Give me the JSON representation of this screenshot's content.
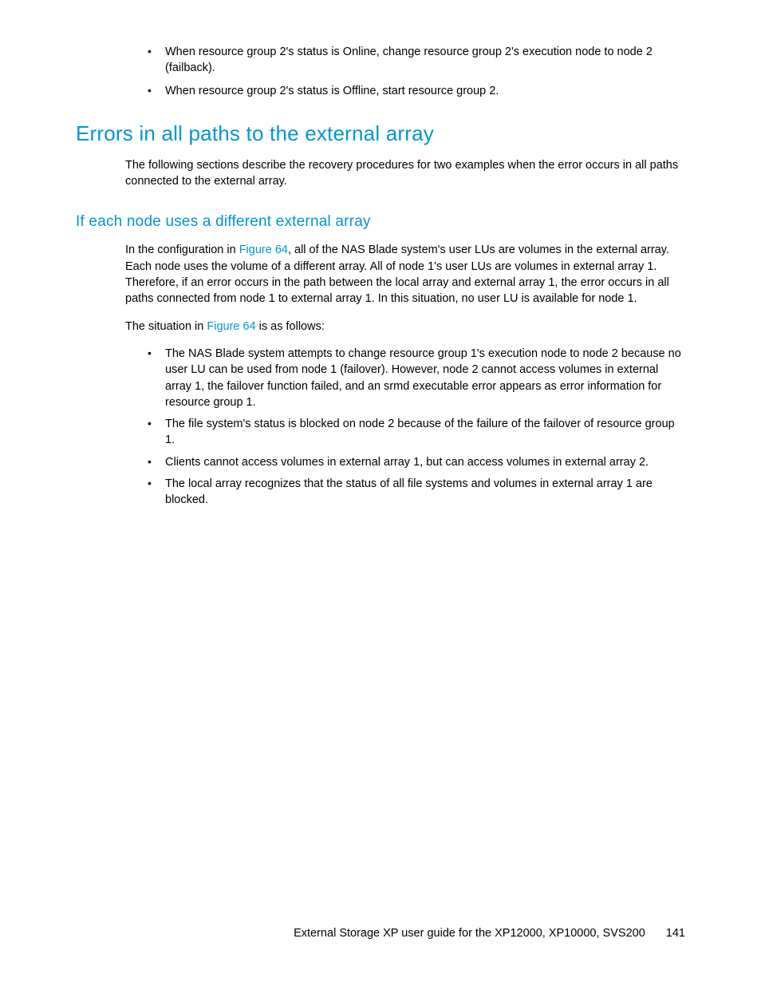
{
  "topBullets": [
    "When resource group 2's status is Online, change resource group 2's execution node to node 2 (failback).",
    "When resource group 2's status is Offline, start resource group 2."
  ],
  "heading1": "Errors in all paths to the external array",
  "intro1": "The following sections describe the recovery procedures for two examples when the error occurs in all paths connected to the external array.",
  "heading2": "If each node uses a different external array",
  "para2_prefix": "In the configuration in ",
  "figure_link": "Figure 64",
  "para2_suffix": ", all of the NAS Blade system's user LUs are volumes in the external array. Each node uses the volume of a different array. All of node 1's user LUs are volumes in external array 1. Therefore, if an error occurs in the path between the local array and external array 1, the error occurs in all paths connected from node 1 to external array 1. In this situation, no user LU is available for node 1.",
  "para3_prefix": "The situation in ",
  "para3_suffix": " is as follows:",
  "subBullets": [
    "The NAS Blade system attempts to change resource group 1's execution node to node 2 because no user LU can be used from node 1 (failover). However, node 2 cannot access volumes in external array 1, the failover function failed, and an srmd executable error appears as error information for resource group 1.",
    "The file system's status is blocked on node 2 because of the failure of the failover of resource group 1.",
    "Clients cannot access volumes in external array 1, but can access volumes in external array 2.",
    "The local array recognizes that the status of all file systems and volumes in external array 1 are blocked."
  ],
  "footer_title": "External Storage XP user guide for the XP12000, XP10000, SVS200",
  "footer_page": "141"
}
